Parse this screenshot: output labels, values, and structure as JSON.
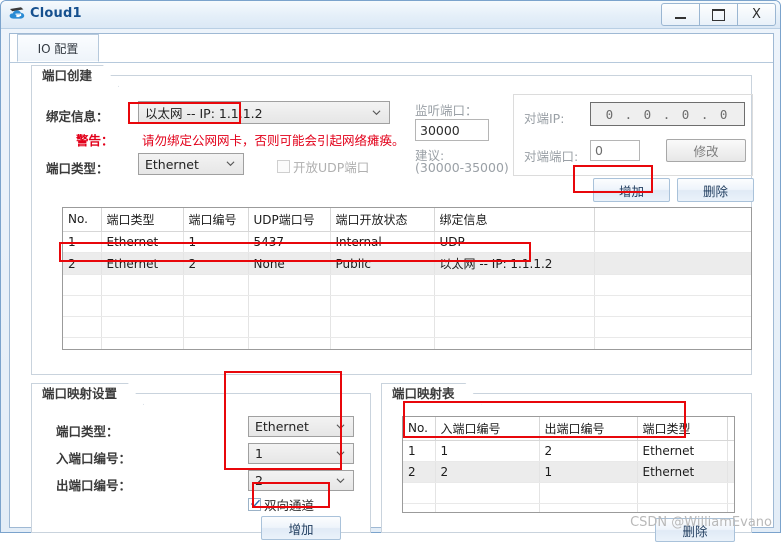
{
  "window": {
    "title": "Cloud1",
    "icon": "cloud-icon",
    "buttons": {
      "minimize": "–",
      "maximize": "□",
      "close": "X"
    }
  },
  "tabs": [
    {
      "label": "IO 配置",
      "selected": true
    }
  ],
  "port_create": {
    "title": "端口创建",
    "binding_label": "绑定信息：",
    "binding_value": "以太网 -- IP: 1.1.1.2",
    "warning_label": "警告：",
    "warning_text": "请勿绑定公网网卡，否则可能会引起网络瘫痪。",
    "port_type_label": "端口类型：",
    "port_type_value": "Ethernet",
    "udp_checkbox_label": "开放UDP端口",
    "udp_checked": false,
    "listen_port_label": "监听端口：",
    "listen_port_value": "30000",
    "suggest_line1": "建议:",
    "suggest_line2": "(30000-35000)",
    "peer_ip_label": "对端IP:",
    "peer_ip_value": "0 . 0 . 0 . 0",
    "peer_port_label": "对端端口:",
    "peer_port_value": "0",
    "modify_button": "修改",
    "add_button": "增加",
    "delete_button": "删除"
  },
  "port_table": {
    "headers": [
      "No.",
      "端口类型",
      "端口编号",
      "UDP端口号",
      "端口开放状态",
      "绑定信息",
      ""
    ],
    "rows": [
      {
        "no": "1",
        "type": "Ethernet",
        "num": "1",
        "udp": "5437",
        "state": "Internal",
        "binding": "UDP",
        "pad": "",
        "selected": false
      },
      {
        "no": "2",
        "type": "Ethernet",
        "num": "2",
        "udp": "None",
        "state": "Public",
        "binding": "以太网 -- IP: 1.1.1.2",
        "pad": "",
        "selected": true
      }
    ],
    "empty_rows": 6
  },
  "mapping_settings": {
    "title": "端口映射设置",
    "port_type_label": "端口类型：",
    "port_type_value": "Ethernet",
    "in_port_label": "入端口编号：",
    "in_port_value": "1",
    "out_port_label": "出端口编号：",
    "out_port_value": "2",
    "bidirectional_label": "双向通道",
    "bidirectional_checked": true,
    "add_button": "增加"
  },
  "mapping_table": {
    "title": "端口映射表",
    "headers": [
      "No.",
      "入端口编号",
      "出端口编号",
      "端口类型",
      ""
    ],
    "rows": [
      {
        "no": "1",
        "in": "1",
        "out": "2",
        "type": "Ethernet",
        "pad": "",
        "selected": false
      },
      {
        "no": "2",
        "in": "2",
        "out": "1",
        "type": "Ethernet",
        "pad": "",
        "selected": true
      }
    ],
    "empty_rows": 3,
    "delete_button": "删除"
  },
  "watermark": "CSDN @WilliamEvano",
  "colors": {
    "annotation": "#e8070b",
    "warning": "#e2001a",
    "title": "#16508e"
  }
}
